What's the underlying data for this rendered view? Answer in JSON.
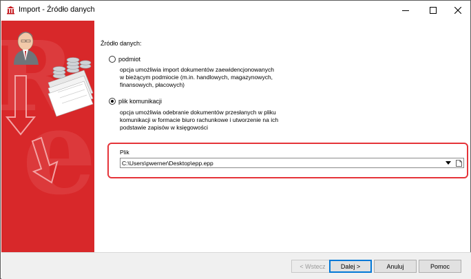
{
  "window": {
    "title": "Import - Źródło danych",
    "minimize_icon": "minimize-icon",
    "maximize_icon": "maximize-icon",
    "close_icon": "close-icon"
  },
  "main": {
    "section_label": "Źródło danych:",
    "options": [
      {
        "label": "podmiot",
        "selected": false,
        "description_lines": [
          "opcja umożliwia import dokumentów zaewidencjonowanych",
          "w bieżącym podmiocie (m.in. handlowych, magazynowych,",
          "finansowych, płacowych)"
        ]
      },
      {
        "label": "plik komunikacji",
        "selected": true,
        "description_lines": [
          "opcja umożliwia odebranie dokumentów przesłanych w pliku",
          "komunikacji w formacie biuro rachunkowe i utworzenie na ich",
          "podstawie zapisów w księgowości"
        ]
      }
    ],
    "file": {
      "label": "Plik",
      "value": "C:\\Users\\pwerner\\Desktop\\epp.epp"
    }
  },
  "footer": {
    "back_label": "< Wstecz",
    "next_label": "Dalej >",
    "cancel_label": "Anuluj",
    "help_label": "Pomoc"
  },
  "colors": {
    "sidebar_red": "#d8282a",
    "highlight_red": "#e53238",
    "focus_blue": "#0078d7"
  }
}
